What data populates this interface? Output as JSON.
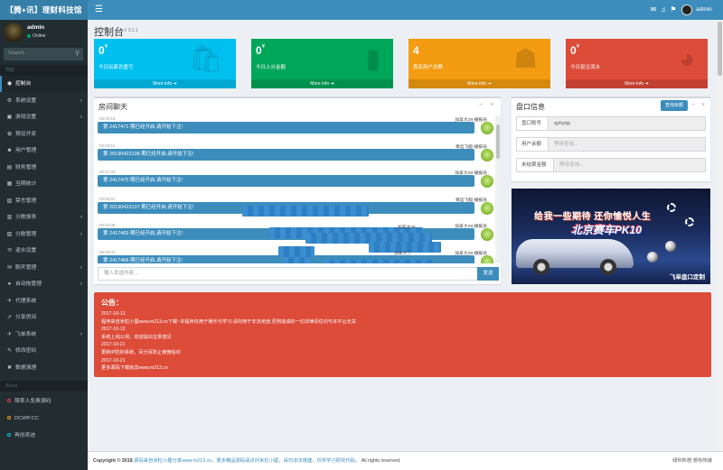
{
  "header": {
    "logo": "【腾+讯】理财科技馆",
    "toggle_icon": "hamburger-icon",
    "icons": [
      "mail-icon",
      "bell-icon",
      "flag-icon"
    ],
    "username": "admin"
  },
  "sidebar": {
    "user": {
      "name": "admin",
      "status": "Online"
    },
    "search_placeholder": "Search...",
    "nav_header": "导航",
    "items": [
      {
        "label": "控制台",
        "icon": "dashboard-icon",
        "glyph": "◉",
        "active": true,
        "chevron": false
      },
      {
        "label": "系统设置",
        "icon": "gears-icon",
        "glyph": "⚙",
        "active": false,
        "chevron": true
      },
      {
        "label": "游戏设置",
        "icon": "gamepad-icon",
        "glyph": "▣",
        "active": false,
        "chevron": true
      },
      {
        "label": "预设开奖",
        "icon": "gear-icon",
        "glyph": "✿",
        "active": false,
        "chevron": false
      },
      {
        "label": "用户管理",
        "icon": "users-icon",
        "glyph": "☻",
        "active": false,
        "chevron": false
      },
      {
        "label": "财务管理",
        "icon": "finance-icon",
        "glyph": "▤",
        "active": false,
        "chevron": false
      },
      {
        "label": "当期统计",
        "icon": "calendar-icon",
        "glyph": "▦",
        "active": false,
        "chevron": false
      },
      {
        "label": "禁言管理",
        "icon": "mute-icon",
        "glyph": "▨",
        "active": false,
        "chevron": false
      },
      {
        "label": "分数报表",
        "icon": "report-icon",
        "glyph": "▥",
        "active": false,
        "chevron": true
      },
      {
        "label": "分数管理",
        "icon": "score-icon",
        "glyph": "▧",
        "active": false,
        "chevron": true
      },
      {
        "label": "退水设置",
        "icon": "refund-icon",
        "glyph": "⟲",
        "active": false,
        "chevron": false
      },
      {
        "label": "聊天管理",
        "icon": "chat-icon",
        "glyph": "✉",
        "active": false,
        "chevron": true
      },
      {
        "label": "自动拖管理",
        "icon": "robot-icon",
        "glyph": "♠",
        "active": false,
        "chevron": true
      },
      {
        "label": "代理系统",
        "icon": "agent-icon",
        "glyph": "✈",
        "active": false,
        "chevron": false
      },
      {
        "label": "分享房间",
        "icon": "share-icon",
        "glyph": "⇗",
        "active": false,
        "chevron": false
      },
      {
        "label": "飞单系统",
        "icon": "plane-icon",
        "glyph": "✈",
        "active": false,
        "chevron": true
      },
      {
        "label": "修改密码",
        "icon": "key-icon",
        "glyph": "✎",
        "active": false,
        "chevron": false
      },
      {
        "label": "数据清理",
        "icon": "trash-icon",
        "glyph": "✖",
        "active": false,
        "chevron": false
      }
    ],
    "about_header": "About",
    "links": [
      {
        "label": "萌草人免费源码",
        "color": "#dd4b39"
      },
      {
        "label": "DCWP.CC",
        "color": "#f39c12"
      },
      {
        "label": "再创奇迹",
        "color": "#00c0ef"
      }
    ]
  },
  "page": {
    "title": "控制台",
    "version": "V 3.2.1"
  },
  "stats": [
    {
      "value": "0",
      "unit": "¥",
      "label": "今日玩家总盈亏",
      "more": "More info",
      "color": "#00c0ef",
      "icon": "bag-icon",
      "glyph": "🛍"
    },
    {
      "value": "0",
      "unit": "¥",
      "label": "今日上分金额",
      "more": "More info",
      "color": "#00a65a",
      "icon": "bar-chart-icon",
      "glyph": "▮"
    },
    {
      "value": "4",
      "unit": "",
      "label": "真实用户总数",
      "more": "More info",
      "color": "#f39c12",
      "icon": "user-add-icon",
      "glyph": "☗"
    },
    {
      "value": "0",
      "unit": "¥",
      "label": "今日投注流水",
      "more": "More info",
      "color": "#dd4b39",
      "icon": "pie-chart-icon",
      "glyph": "◕"
    }
  ],
  "chat": {
    "title": "房间聊天",
    "messages": [
      {
        "time": "00:02:18",
        "who": "加拿大28-播报员",
        "text": "第 2417471 期已经开启,请开始下注!"
      },
      {
        "time": "00:00:11",
        "who": "幸运飞艇-播报员",
        "text": "第 20190422138 期已经开启,请开始下注!"
      },
      {
        "time": "00:07:29",
        "who": "加拿大28-播报员",
        "text": "第 2417470 期已经开启,请开始下注!"
      },
      {
        "time": "00:04:57",
        "who": "幸运飞艇-播报员",
        "text": "第 20190422137 期已经开启,请开始下注!"
      },
      {
        "time": "00:04:09",
        "who": "加拿大28-播报员",
        "text": "第 2417469 期已经开启,请开始下注!"
      },
      {
        "time": "00:00:00",
        "who": "加拿大28-播报员",
        "text": "第 2417468 期已经开启,请开始下注!"
      }
    ],
    "blur_texts": [
      "加拿大28",
      "加拿大二"
    ],
    "input_placeholder": "输入发送内容 ...",
    "send_label": "发送"
  },
  "account": {
    "title": "盘口信息",
    "query_label": "查询余额",
    "fields": [
      {
        "label": "盘口账号",
        "value": "qyhyqq",
        "placeholder": false
      },
      {
        "label": "用户余额",
        "value": "等待查询...",
        "placeholder": true
      },
      {
        "label": "未结算金额",
        "value": "等待查询...",
        "placeholder": true
      }
    ]
  },
  "banner": {
    "slogan": "给我一些期待 还你愉悦人生",
    "game": "北京赛车PK10",
    "caption": "飞单盘口定制"
  },
  "notice": {
    "title": "公告：",
    "lines": [
      "2017-10-13",
      "程序来自米粒小屋www.m213.cn下载~本程序仅用于娱乐与学习,请勿用于非法用途,否则造成的一切法律责任均与本平台无关",
      "2017-10-12",
      "系统上线公测，欢迎提出宝贵意见",
      "2017-10-21",
      "更新IP防封系统，百分百防止被微信封",
      "2017-10-21",
      "更多源码下载就去www.m213.cn"
    ]
  },
  "footer": {
    "prefix": "Copyright © 2018",
    "link": "源码来自米粒小屋分享www.m213.cn，更多精品源码请访问米粒小屋，请勿非法搭建，仅供学习研究代码。",
    "suffix": "All rights reserved.",
    "right": "绿你所想 想你所做"
  }
}
